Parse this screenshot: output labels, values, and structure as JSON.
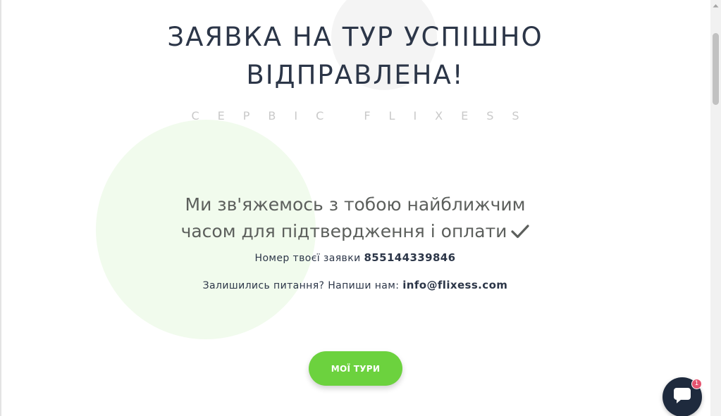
{
  "header": {
    "title_line1": "ЗАЯВКА НА ТУР УСПІШНО",
    "title_line2": "ВІДПРАВЛЕНА!",
    "subtitle": "СЕРВІС FLIXESS"
  },
  "main": {
    "message_line1": "Ми зв'яжемось з тобою найближчим",
    "message_line2": "часом для підтвердження і оплати",
    "message_icon": "check-icon",
    "order_label": "Номер твоєї заявки",
    "order_number": "855144339846",
    "contact_label": "Залишились питання? Напиши нам:",
    "contact_email": "info@flixess.com"
  },
  "actions": {
    "tours_button_label": "МОЇ ТУРИ"
  },
  "chat_widget": {
    "icon": "chat-bubble-icon",
    "badge_count": "1"
  },
  "colors": {
    "accent": "#6cd23e",
    "title": "#2c3648",
    "chat": "#1e2a3d",
    "badge": "#e5546f",
    "circle": "#f1fbed"
  }
}
